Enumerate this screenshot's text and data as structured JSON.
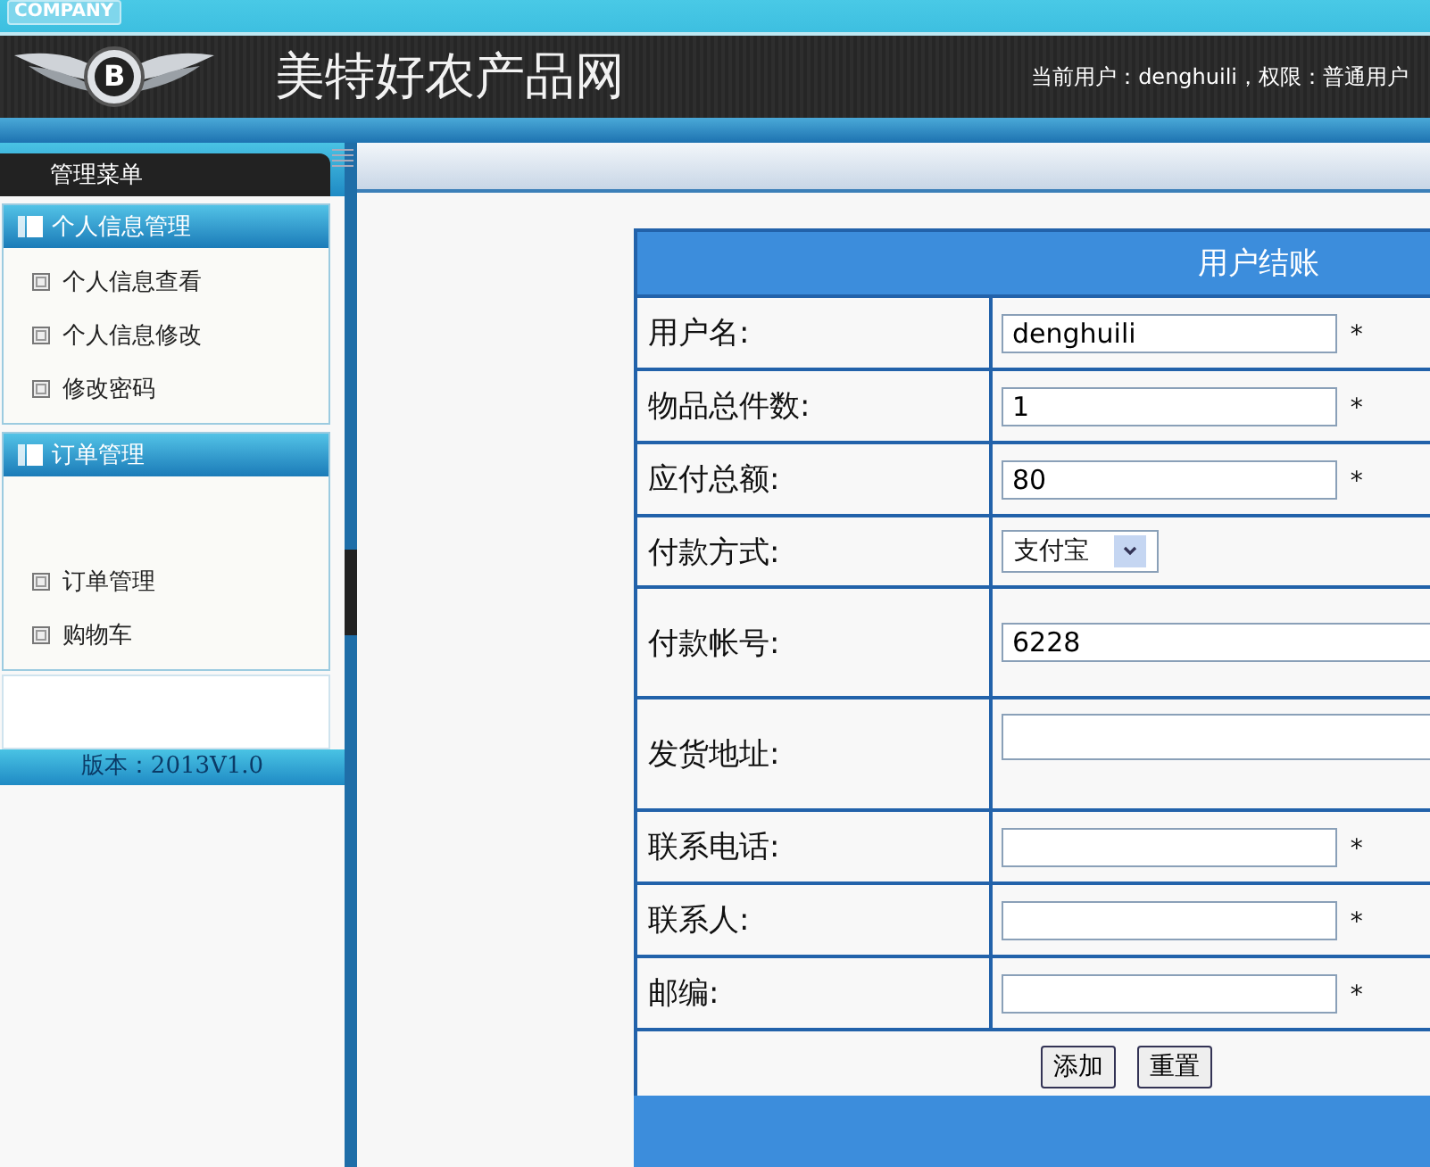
{
  "header": {
    "badge": "COMPANY",
    "logo_letter": "B",
    "site_title": "美特好农产品网",
    "user_info": "当前用户：denghuili，权限：普通用户"
  },
  "sidebar": {
    "title": "管理菜单",
    "groups": [
      {
        "title": "个人信息管理",
        "items": [
          {
            "label": "个人信息查看"
          },
          {
            "label": "个人信息修改"
          },
          {
            "label": "修改密码"
          }
        ]
      },
      {
        "title": "订单管理",
        "items": [
          {
            "label": "订单管理"
          },
          {
            "label": "购物车"
          }
        ]
      }
    ],
    "version": "版本：2013V1.0"
  },
  "form": {
    "title": "用户结账",
    "rows": [
      {
        "label": "用户名:",
        "kind": "text",
        "value": "denghuili",
        "required": "*"
      },
      {
        "label": "物品总件数:",
        "kind": "text",
        "value": "1",
        "required": "*"
      },
      {
        "label": "应付总额:",
        "kind": "text",
        "value": "80",
        "required": "*"
      },
      {
        "label": "付款方式:",
        "kind": "select",
        "value": "支付宝"
      },
      {
        "label": "付款帐号:",
        "kind": "wide",
        "value": "6228"
      },
      {
        "label": "发货地址:",
        "kind": "area"
      },
      {
        "label": "联系电话:",
        "kind": "text",
        "required": "*"
      },
      {
        "label": "联系人:",
        "kind": "text",
        "required": "*"
      },
      {
        "label": "邮编:",
        "kind": "text",
        "required": "*"
      }
    ],
    "buttons": [
      "添加",
      "重置"
    ]
  }
}
